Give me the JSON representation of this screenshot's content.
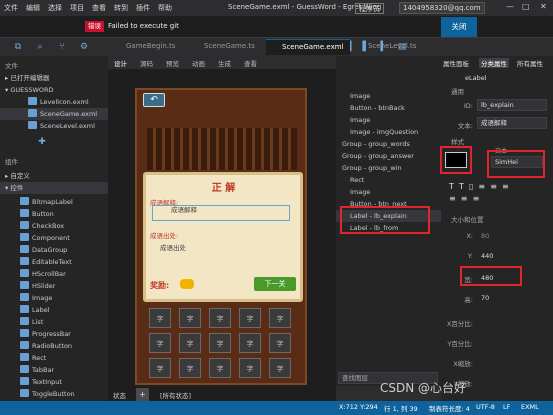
{
  "menu": [
    "文件",
    "编辑",
    "选择",
    "项目",
    "查看",
    "转到",
    "插件",
    "帮助"
  ],
  "window_title": "SceneGame.exml - GuessWord - Egret Wing",
  "role": "程序员",
  "user": "1404958320@qq.com",
  "notice": {
    "badge": "错误",
    "text": "Failed to execute git",
    "close": "关闭"
  },
  "tabs": [
    "GameBegin.ts",
    "SceneGame.ts",
    "SceneGame.exml",
    "SceneLevel.ts"
  ],
  "left": {
    "files_title": "文件",
    "open_editors": "已打开编辑器",
    "project": "GUESSWORD",
    "files": [
      "LevelIcon.exml",
      "SceneGame.exml",
      "SceneLevel.exml"
    ],
    "components_title": "组件",
    "custom": "自定义",
    "controls": "控件",
    "controls_list": [
      "BitmapLabel",
      "Button",
      "CheckBox",
      "Component",
      "DataGroup",
      "EditableText",
      "HScrollBar",
      "HSlider",
      "Image",
      "Label",
      "List",
      "ProgressBar",
      "RadioButton",
      "Rect",
      "TabBar",
      "TextInput",
      "ToggleButton"
    ]
  },
  "editor": {
    "tools": [
      "设计",
      "源码",
      "预览",
      "动画",
      "生成",
      "查看"
    ],
    "game": {
      "title": "正 解",
      "explain_label": "成语解释:",
      "explain_value": "成语解释",
      "from_label": "成语出处:",
      "from_value": "成语出处",
      "reward": "奖励:",
      "next_btn": "下一关",
      "zi": "字"
    }
  },
  "outline": {
    "items": [
      "Image",
      "Button - btnBack",
      "Image",
      "Image - imgQuestion",
      "Group - group_words",
      "Group - group_answer",
      "Group - group_win",
      "Rect",
      "Image",
      "Button - btn_next",
      "Label - lb_explain",
      "Label - lb_from"
    ],
    "search": "查找图层"
  },
  "props": {
    "tabs": [
      "属性面板",
      "分类属性",
      "所有属性"
    ],
    "class": "eLabel",
    "common": "通用",
    "id_label": "ID:",
    "id_value": "lb_explain",
    "text_label": "文本:",
    "text_value": "成语解释",
    "style": "样式",
    "text_hint": "文本",
    "font": "SimHei",
    "size_pos": "大小和位置",
    "x_label": "X:",
    "x_value": "80",
    "y_label": "Y:",
    "y_value": "440",
    "w_label": "宽:",
    "w_value": "480",
    "h_label": "高:",
    "h_value": "70",
    "xr": "X百分比:",
    "yr": "Y百分比:",
    "xs": "X缩放:",
    "ys": "Y缩放:"
  },
  "status": {
    "left": "状态",
    "states": "[所有状态]",
    "coords": "X:712 Y:294",
    "row": "行 1, 列 39",
    "tab": "制表符长度: 4",
    "enc": "UTF-8",
    "eol": "LF",
    "lang": "EXML"
  },
  "watermark": "CSDN @心台好",
  "colors": {
    "accent": "#0e639c",
    "error": "#c8102e",
    "highlight": "#e0262c"
  }
}
